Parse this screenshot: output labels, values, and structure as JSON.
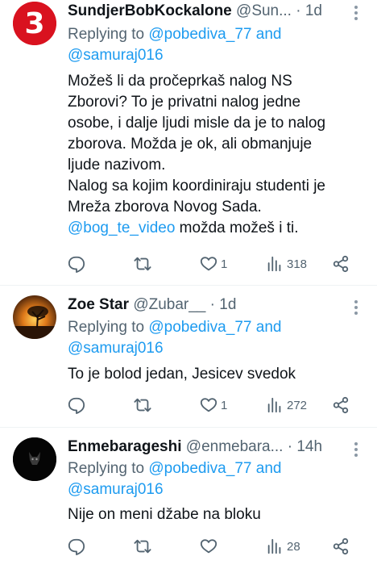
{
  "tweets": [
    {
      "name": "SundjerBobKockalone",
      "handle": "@Sun...",
      "time": "· 1d",
      "replying_prefix": "Replying to",
      "reply_user1": "@pobediva_77",
      "reply_and": "and",
      "reply_user2": "@samuraj016",
      "lines": [
        "Možeš li da pročeprkaš nalog NS",
        "Zborovi? To je privatni nalog jedne",
        "osobe, i dalje ljudi misle da je to nalog",
        "zborova. Možda je ok,  ali obmanjuje",
        "ljude nazivom.",
        "Nalog sa kojim koordiniraju studenti je",
        "Mreža zborova Novog Sada."
      ],
      "mention": "@bog_te_video",
      "mention_rest": " možda možeš i ti.",
      "likes": "1",
      "views": "318",
      "avatar_text": "3"
    },
    {
      "name": "Zoe Star",
      "handle": "@Zubar__",
      "time": "· 1d",
      "replying_prefix": "Replying to",
      "reply_user1": "@pobediva_77",
      "reply_and": "and",
      "reply_user2": "@samuraj016",
      "lines": [
        "To je bolod jedan, Jesicev svedok"
      ],
      "likes": "1",
      "views": "272"
    },
    {
      "name": "Enmebarageshi",
      "handle": "@enmebara...",
      "time": "· 14h",
      "replying_prefix": "Replying to",
      "reply_user1": "@pobediva_77",
      "reply_and": "and",
      "reply_user2": "@samuraj016",
      "lines": [
        "Nije on meni džabe na bloku"
      ],
      "likes": "",
      "views": "28"
    }
  ],
  "colors": {
    "accent": "#1d9bf0",
    "muted": "#536471",
    "badge_red": "#d9121f"
  },
  "icons": [
    "reply-icon",
    "retweet-icon",
    "like-icon",
    "views-icon",
    "share-icon",
    "more-icon"
  ]
}
